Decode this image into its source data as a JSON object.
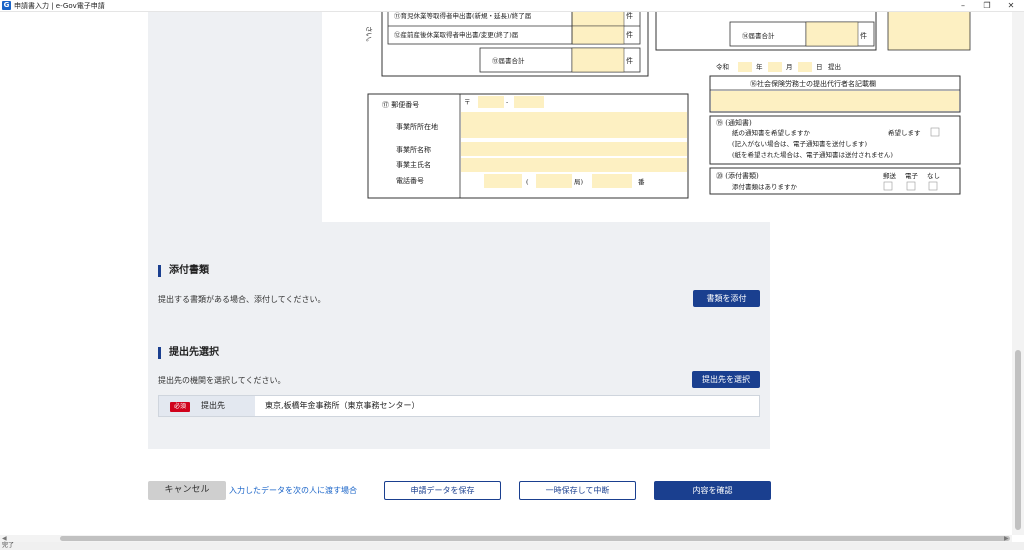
{
  "window": {
    "logo": "G",
    "title": "申請書入力 | e-Gov電子申請",
    "minimize": "–",
    "restore": "❐",
    "close": "✕"
  },
  "form": {
    "row_childcare": "⑪育児休業等取得者申出書(新規・延長)/終了届",
    "row_maternity": "⑫産前産後休業取得者申出書/変更(終了)届",
    "unit": "件",
    "total_13": "⑬届書合計",
    "total_right": "⑭届書合計",
    "side_text": "さい。",
    "date_era": "令和",
    "date_year": "年",
    "date_month": "月",
    "date_day": "日",
    "date_submit": "提出",
    "agent_title": "⑯社会保険労務士の提出代行者名記載欄",
    "postal_label": "⑰ 郵便番号",
    "postal_mark": "〒",
    "postal_dash": "-",
    "office_address": "事業所所在地",
    "office_name": "事業所名称",
    "owner_name": "事業主氏名",
    "phone": "電話番号",
    "phone_paren": "(",
    "phone_bureau": "局)",
    "phone_number": "番",
    "notice_title": "⑲ (通知書)",
    "notice_q": "紙の通知書を希望しますか",
    "notice_hope": "希望します",
    "notice_note1": "(記入がない場合は、電子通知書を送付します)",
    "notice_note2": "(紙を希望された場合は、電子通知書は送付されません)",
    "attach_title": "⑳ (添付書類)",
    "attach_q": "添付書類はありますか",
    "attach_mail": "郵送",
    "attach_electronic": "電子",
    "attach_none": "なし"
  },
  "attachments": {
    "title": "添付書類",
    "desc": "提出する書類がある場合、添付してください。",
    "button": "書類を添付"
  },
  "destination": {
    "title": "提出先選択",
    "desc": "提出先の機関を選択してください。",
    "button": "提出先を選択",
    "required": "必須",
    "label": "提出先",
    "value": "東京,板橋年金事務所（東京事務センター）"
  },
  "actions": {
    "cancel": "キャンセル",
    "handover": "入力したデータを次の人に渡す場合",
    "save": "申請データを保存",
    "suspend": "一時保存して中断",
    "confirm": "内容を確認"
  },
  "status": {
    "text": "完了"
  },
  "colors": {
    "accent": "#1a3f8f",
    "input_fill": "#fdf0c2",
    "required": "#d0021b"
  }
}
